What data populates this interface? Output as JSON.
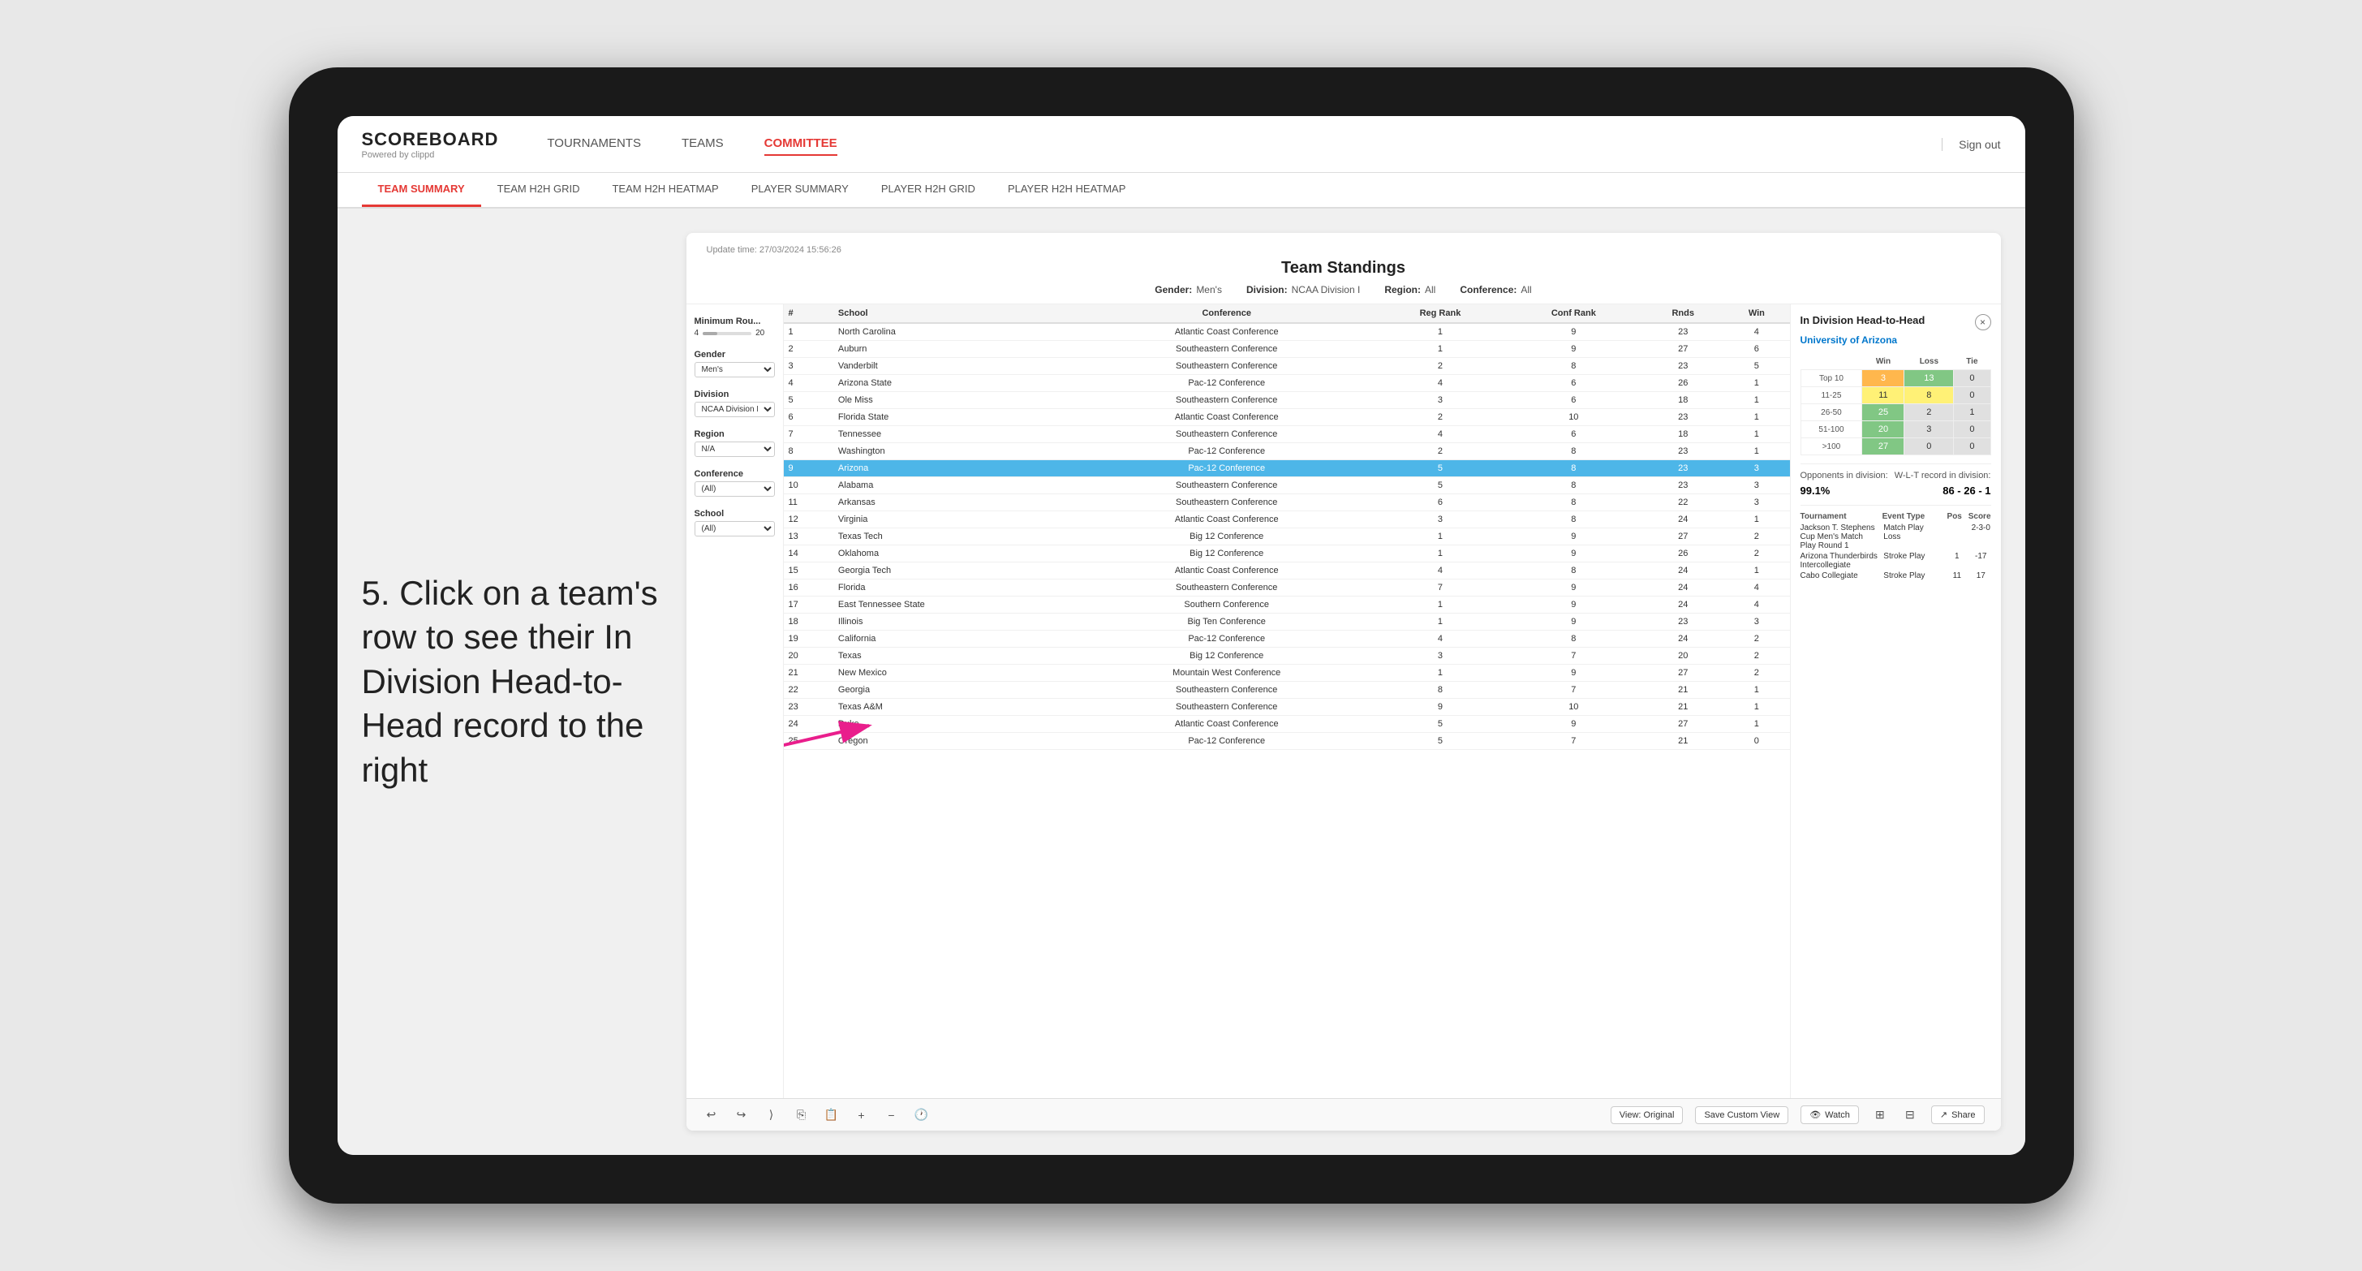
{
  "app": {
    "logo": "SCOREBOARD",
    "logo_sub": "Powered by clippd",
    "sign_out": "Sign out"
  },
  "nav": {
    "links": [
      {
        "label": "TOURNAMENTS",
        "active": false
      },
      {
        "label": "TEAMS",
        "active": false
      },
      {
        "label": "COMMITTEE",
        "active": true
      }
    ],
    "sub_links": [
      {
        "label": "TEAM SUMMARY",
        "active": true
      },
      {
        "label": "TEAM H2H GRID",
        "active": false
      },
      {
        "label": "TEAM H2H HEATMAP",
        "active": false
      },
      {
        "label": "PLAYER SUMMARY",
        "active": false
      },
      {
        "label": "PLAYER H2H GRID",
        "active": false
      },
      {
        "label": "PLAYER H2H HEATMAP",
        "active": false
      }
    ]
  },
  "panel": {
    "update_time": "Update time: 27/03/2024 15:56:26",
    "title": "Team Standings",
    "filters": {
      "gender_label": "Gender:",
      "gender_value": "Men's",
      "division_label": "Division:",
      "division_value": "NCAA Division I",
      "region_label": "Region:",
      "region_value": "All",
      "conference_label": "Conference:",
      "conference_value": "All"
    }
  },
  "sidebar_filters": {
    "min_rounds_label": "Minimum Rou...",
    "min_rounds_val": "4",
    "min_rounds_max": "20",
    "gender_label": "Gender",
    "gender_select": "Men's",
    "division_label": "Division",
    "division_select": "NCAA Division I",
    "region_label": "Region",
    "region_select": "N/A",
    "conference_label": "Conference",
    "conference_select": "(All)",
    "school_label": "School",
    "school_select": "(All)"
  },
  "table": {
    "headers": [
      "#",
      "School",
      "Conference",
      "Reg Rank",
      "Conf Rank",
      "Rds",
      "Win"
    ],
    "rows": [
      {
        "rank": 1,
        "school": "North Carolina",
        "conference": "Atlantic Coast Conference",
        "reg_rank": 1,
        "conf_rank": 9,
        "rds": 23,
        "win": 4
      },
      {
        "rank": 2,
        "school": "Auburn",
        "conference": "Southeastern Conference",
        "reg_rank": 1,
        "conf_rank": 9,
        "rds": 27,
        "win": 6
      },
      {
        "rank": 3,
        "school": "Vanderbilt",
        "conference": "Southeastern Conference",
        "reg_rank": 2,
        "conf_rank": 8,
        "rds": 23,
        "win": 5
      },
      {
        "rank": 4,
        "school": "Arizona State",
        "conference": "Pac-12 Conference",
        "reg_rank": 4,
        "conf_rank": 6,
        "rds": 26,
        "win": 1
      },
      {
        "rank": 5,
        "school": "Ole Miss",
        "conference": "Southeastern Conference",
        "reg_rank": 3,
        "conf_rank": 6,
        "rds": 18,
        "win": 1
      },
      {
        "rank": 6,
        "school": "Florida State",
        "conference": "Atlantic Coast Conference",
        "reg_rank": 2,
        "conf_rank": 10,
        "rds": 23,
        "win": 1
      },
      {
        "rank": 7,
        "school": "Tennessee",
        "conference": "Southeastern Conference",
        "reg_rank": 4,
        "conf_rank": 6,
        "rds": 18,
        "win": 1
      },
      {
        "rank": 8,
        "school": "Washington",
        "conference": "Pac-12 Conference",
        "reg_rank": 2,
        "conf_rank": 8,
        "rds": 23,
        "win": 1
      },
      {
        "rank": 9,
        "school": "Arizona",
        "conference": "Pac-12 Conference",
        "reg_rank": 5,
        "conf_rank": 8,
        "rds": 23,
        "win": 3,
        "highlighted": true
      },
      {
        "rank": 10,
        "school": "Alabama",
        "conference": "Southeastern Conference",
        "reg_rank": 5,
        "conf_rank": 8,
        "rds": 23,
        "win": 3
      },
      {
        "rank": 11,
        "school": "Arkansas",
        "conference": "Southeastern Conference",
        "reg_rank": 6,
        "conf_rank": 8,
        "rds": 22,
        "win": 3
      },
      {
        "rank": 12,
        "school": "Virginia",
        "conference": "Atlantic Coast Conference",
        "reg_rank": 3,
        "conf_rank": 8,
        "rds": 24,
        "win": 1
      },
      {
        "rank": 13,
        "school": "Texas Tech",
        "conference": "Big 12 Conference",
        "reg_rank": 1,
        "conf_rank": 9,
        "rds": 27,
        "win": 2
      },
      {
        "rank": 14,
        "school": "Oklahoma",
        "conference": "Big 12 Conference",
        "reg_rank": 1,
        "conf_rank": 9,
        "rds": 26,
        "win": 2
      },
      {
        "rank": 15,
        "school": "Georgia Tech",
        "conference": "Atlantic Coast Conference",
        "reg_rank": 4,
        "conf_rank": 8,
        "rds": 24,
        "win": 1
      },
      {
        "rank": 16,
        "school": "Florida",
        "conference": "Southeastern Conference",
        "reg_rank": 7,
        "conf_rank": 9,
        "rds": 24,
        "win": 4
      },
      {
        "rank": 17,
        "school": "East Tennessee State",
        "conference": "Southern Conference",
        "reg_rank": 1,
        "conf_rank": 9,
        "rds": 24,
        "win": 4
      },
      {
        "rank": 18,
        "school": "Illinois",
        "conference": "Big Ten Conference",
        "reg_rank": 1,
        "conf_rank": 9,
        "rds": 23,
        "win": 3
      },
      {
        "rank": 19,
        "school": "California",
        "conference": "Pac-12 Conference",
        "reg_rank": 4,
        "conf_rank": 8,
        "rds": 24,
        "win": 2
      },
      {
        "rank": 20,
        "school": "Texas",
        "conference": "Big 12 Conference",
        "reg_rank": 3,
        "conf_rank": 7,
        "rds": 20,
        "win": 2
      },
      {
        "rank": 21,
        "school": "New Mexico",
        "conference": "Mountain West Conference",
        "reg_rank": 1,
        "conf_rank": 9,
        "rds": 27,
        "win": 2
      },
      {
        "rank": 22,
        "school": "Georgia",
        "conference": "Southeastern Conference",
        "reg_rank": 8,
        "conf_rank": 7,
        "rds": 21,
        "win": 1
      },
      {
        "rank": 23,
        "school": "Texas A&M",
        "conference": "Southeastern Conference",
        "reg_rank": 9,
        "conf_rank": 10,
        "rds": 21,
        "win": 1
      },
      {
        "rank": 24,
        "school": "Duke",
        "conference": "Atlantic Coast Conference",
        "reg_rank": 5,
        "conf_rank": 9,
        "rds": 27,
        "win": 1
      },
      {
        "rank": 25,
        "school": "Oregon",
        "conference": "Pac-12 Conference",
        "reg_rank": 5,
        "conf_rank": 7,
        "rds": 21,
        "win": 0
      }
    ]
  },
  "h2h": {
    "title": "In Division Head-to-Head",
    "team": "University of Arizona",
    "close_icon": "×",
    "stats": {
      "headers": [
        "Win",
        "Loss",
        "Tie"
      ],
      "rows": [
        {
          "range": "Top 10",
          "win": 3,
          "loss": 13,
          "tie": 0,
          "win_color": "orange",
          "loss_color": "green"
        },
        {
          "range": "11-25",
          "win": 11,
          "loss": 8,
          "tie": 0,
          "win_color": "yellow",
          "loss_color": "yellow"
        },
        {
          "range": "26-50",
          "win": 25,
          "loss": 2,
          "tie": 1,
          "win_color": "green",
          "loss_color": "gray"
        },
        {
          "range": "51-100",
          "win": 20,
          "loss": 3,
          "tie": 0,
          "win_color": "green",
          "loss_color": "gray"
        },
        {
          "range": ">100",
          "win": 27,
          "loss": 0,
          "tie": 0,
          "win_color": "green",
          "loss_color": "gray"
        }
      ]
    },
    "opponents_label": "Opponents in division:",
    "opponents_value": "99.1%",
    "wl_label": "W-L-T record in division:",
    "wl_value": "86 - 26 - 1",
    "tournaments_label": "Tournament",
    "tournament_headers": [
      "Tournament",
      "Event Type",
      "Pos",
      "Score"
    ],
    "tournaments": [
      {
        "name": "Jackson T. Stephens Cup Men's Match Play Round 1",
        "type": "Match Play",
        "result": "Loss",
        "score": "2-3-0"
      },
      {
        "name": "Arizona Thunderbirds Intercollegiate",
        "type": "Stroke Play",
        "pos": 1,
        "score": "-17"
      },
      {
        "name": "Cabo Collegiate",
        "type": "Stroke Play",
        "pos": 11,
        "score": "17"
      }
    ]
  },
  "toolbar": {
    "view_original": "View: Original",
    "save_custom": "Save Custom View",
    "watch": "Watch",
    "share": "Share"
  },
  "annotation": {
    "text": "5. Click on a team's row to see their In Division Head-to-Head record to the right"
  }
}
